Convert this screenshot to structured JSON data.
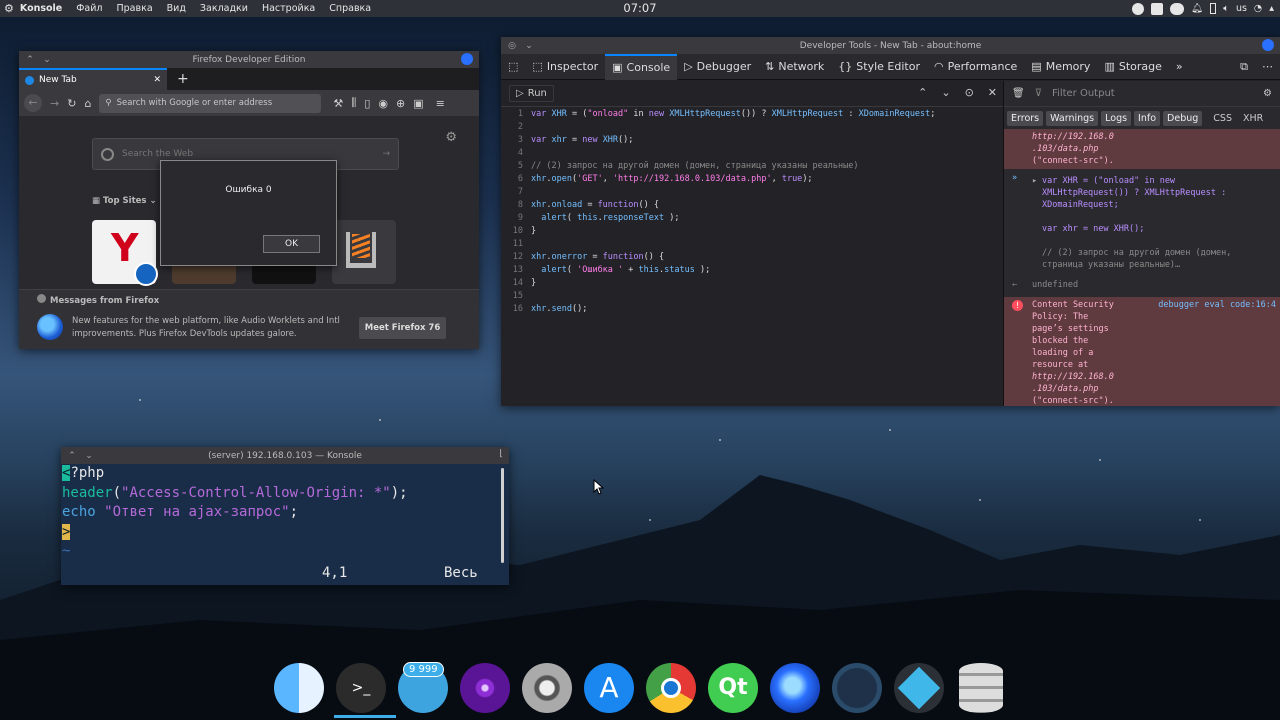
{
  "top_panel": {
    "app_name": "Konsole",
    "menu": [
      "Файл",
      "Правка",
      "Вид",
      "Закладки",
      "Настройка",
      "Справка"
    ],
    "clock": "07:07",
    "keyboard_layout": "us"
  },
  "firefox": {
    "title": "Firefox Developer Edition",
    "tab_label": "New Tab",
    "url_placeholder": "Search with Google or enter address",
    "search_placeholder": "Search the Web",
    "top_sites_label": "Top Sites",
    "dialog_message": "Ошибка 0",
    "dialog_ok": "OK",
    "messages_title": "Messages from Firefox",
    "messages_text": "New features for the web platform, like Audio Worklets and Intl improvements. Plus Firefox DevTools updates galore.",
    "messages_button": "Meet Firefox 76"
  },
  "devtools": {
    "title": "Developer Tools - New Tab - about:home",
    "tabs": [
      "Inspector",
      "Console",
      "Debugger",
      "Network",
      "Style Editor",
      "Performance",
      "Memory",
      "Storage"
    ],
    "active_tab": "Console",
    "run_label": "Run",
    "filter_placeholder": "Filter Output",
    "filters": [
      "Errors",
      "Warnings",
      "Logs",
      "Info",
      "Debug",
      "CSS",
      "XHR"
    ],
    "code": [
      {
        "n": "1",
        "t": "var XHR = (\"onload\" in new XMLHttpRequest()) ? XMLHttpRequest : XDomainRequest;"
      },
      {
        "n": "2",
        "t": ""
      },
      {
        "n": "3",
        "t": "var xhr = new XHR();"
      },
      {
        "n": "4",
        "t": ""
      },
      {
        "n": "5",
        "t": "// (2) запрос на другой домен (домен, страница указаны реальные)"
      },
      {
        "n": "6",
        "t": "xhr.open('GET', 'http://192.168.0.103/data.php', true);"
      },
      {
        "n": "7",
        "t": ""
      },
      {
        "n": "8",
        "t": "xhr.onload = function() {"
      },
      {
        "n": "9",
        "t": "  alert( this.responseText );"
      },
      {
        "n": "10",
        "t": "}"
      },
      {
        "n": "11",
        "t": ""
      },
      {
        "n": "12",
        "t": "xhr.onerror = function() {"
      },
      {
        "n": "13",
        "t": "  alert( 'Ошибка ' + this.status );"
      },
      {
        "n": "14",
        "t": "}"
      },
      {
        "n": "15",
        "t": ""
      },
      {
        "n": "16",
        "t": "xhr.send();"
      }
    ],
    "console_err_top": [
      "http://192.168.0",
      ".103/data.php",
      "(\"connect-src\")."
    ],
    "console_input": [
      "var XHR = (\"onload\" in new",
      "XMLHttpRequest()) ? XMLHttpRequest :",
      "XDomainRequest;",
      "",
      "var xhr = new XHR();",
      "",
      "// (2) запрос на другой домен (домен,",
      "страница указаны реальные)…"
    ],
    "console_result": "undefined",
    "console_err": [
      "Content Security",
      "Policy: The",
      "page’s settings",
      "blocked the",
      "loading of a",
      "resource at",
      "http://192.168.0",
      ".103/data.php",
      "(\"connect-src\")."
    ],
    "console_err_source": "debugger eval code:16:4"
  },
  "konsole": {
    "title": "(server) 192.168.0.103 — Konsole",
    "line1_cursor": "<",
    "line1_rest": "?php",
    "line2_fn": "header",
    "line2_open": "(",
    "line2_str": "\"Access-Control-Allow-Origin: *\"",
    "line2_close": ");",
    "line3_kw": "echo",
    "line3_str": "\"Ответ на ajax-запрос\"",
    "line3_end": ";",
    "line4_cursor": ">",
    "line5": "~",
    "status_pos": "4,1",
    "status_all": "Весь"
  },
  "dock": {
    "badge": "9 999",
    "apps": [
      "finder-icon",
      "terminal-icon",
      "telegram-icon",
      "podcast-icon",
      "settings-icon",
      "app-store-icon",
      "chrome-icon",
      "qt-icon",
      "firefox-icon",
      "monitor-icon",
      "toolbox-icon",
      "database-icon"
    ]
  },
  "colors": {
    "accent": "#3daee9",
    "devtools_accent": "#0a84ff",
    "error_bg": "#5f3a3f"
  }
}
